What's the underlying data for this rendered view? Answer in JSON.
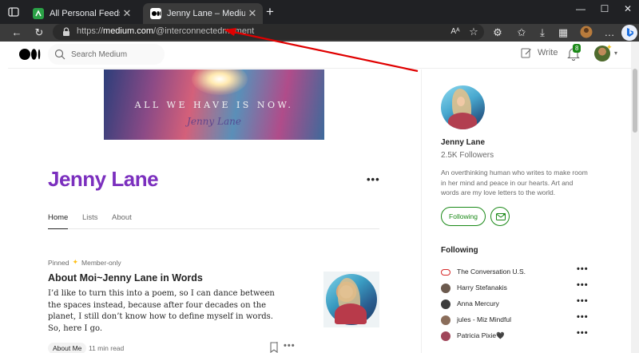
{
  "browser": {
    "tabs": [
      {
        "label": "All Personal Feeds",
        "active": false
      },
      {
        "label": "Jenny Lane – Medium",
        "active": true
      }
    ],
    "address": {
      "scheme": "https://",
      "host": "medium.com",
      "path": "/@interconnectedmoment"
    }
  },
  "medium_header": {
    "search_placeholder": "Search Medium",
    "write_label": "Write",
    "notification_count": "8"
  },
  "profile": {
    "banner_text": "ALL WE HAVE IS NOW.",
    "banner_signature": "Jenny Lane",
    "name": "Jenny Lane",
    "more_label": "•••",
    "tabs": [
      "Home",
      "Lists",
      "About"
    ]
  },
  "post": {
    "pinned_label": "Pinned",
    "member_label": "Member-only",
    "title": "About Moi~Jenny Lane in Words",
    "excerpt": "I’d like to turn this into a poem, so I can dance between the spaces instead, because after four decades on the planet, I still don’t know how to define myself in words. So, here I go.",
    "tag": "About Me",
    "read_time": "11 min read"
  },
  "sidebar": {
    "name": "Jenny Lane",
    "followers": "2.5K Followers",
    "bio": "An overthinking human who writes to make room in her mind and peace in our hearts. Art and words are my love letters to the world.",
    "following_button": "Following",
    "following_title": "Following",
    "following": [
      {
        "name": "The Conversation U.S.",
        "color": "#d62828"
      },
      {
        "name": "Harry Stefanakis",
        "color": "#6b5a4e"
      },
      {
        "name": "Anna Mercury",
        "color": "#3b3b3b"
      },
      {
        "name": "jules - Miz Mindful",
        "color": "#8a6d5a"
      },
      {
        "name": "Patricia Pixie🖤",
        "color": "#a0465a"
      }
    ]
  },
  "colors": {
    "accent_green": "#1a8917",
    "name_purple": "#7b2fbe",
    "annotation_red": "#e00000"
  }
}
